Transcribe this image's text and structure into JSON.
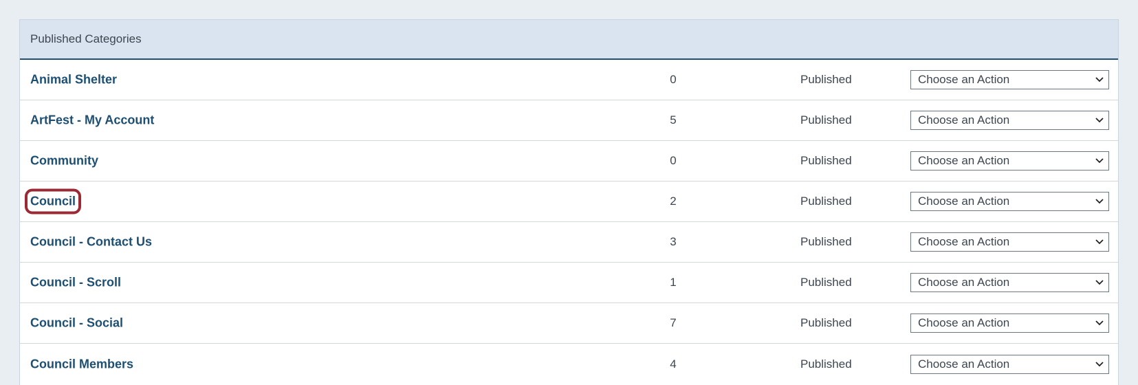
{
  "panel": {
    "title": "Published Categories"
  },
  "rows": [
    {
      "name": "Animal Shelter",
      "count": "0",
      "status": "Published",
      "action": "Choose an Action"
    },
    {
      "name": "ArtFest - My Account",
      "count": "5",
      "status": "Published",
      "action": "Choose an Action"
    },
    {
      "name": "Community",
      "count": "0",
      "status": "Published",
      "action": "Choose an Action"
    },
    {
      "name": "Council",
      "count": "2",
      "status": "Published",
      "action": "Choose an Action",
      "highlighted": true
    },
    {
      "name": "Council - Contact Us",
      "count": "3",
      "status": "Published",
      "action": "Choose an Action"
    },
    {
      "name": "Council - Scroll",
      "count": "1",
      "status": "Published",
      "action": "Choose an Action"
    },
    {
      "name": "Council - Social",
      "count": "7",
      "status": "Published",
      "action": "Choose an Action"
    },
    {
      "name": "Council Members",
      "count": "4",
      "status": "Published",
      "action": "Choose an Action"
    }
  ],
  "colors": {
    "link": "#1d4f73",
    "highlight": "#9b2a35",
    "header_bg": "#d9e4f0"
  },
  "icons": {
    "select_arrow": "chevron-down-icon"
  }
}
